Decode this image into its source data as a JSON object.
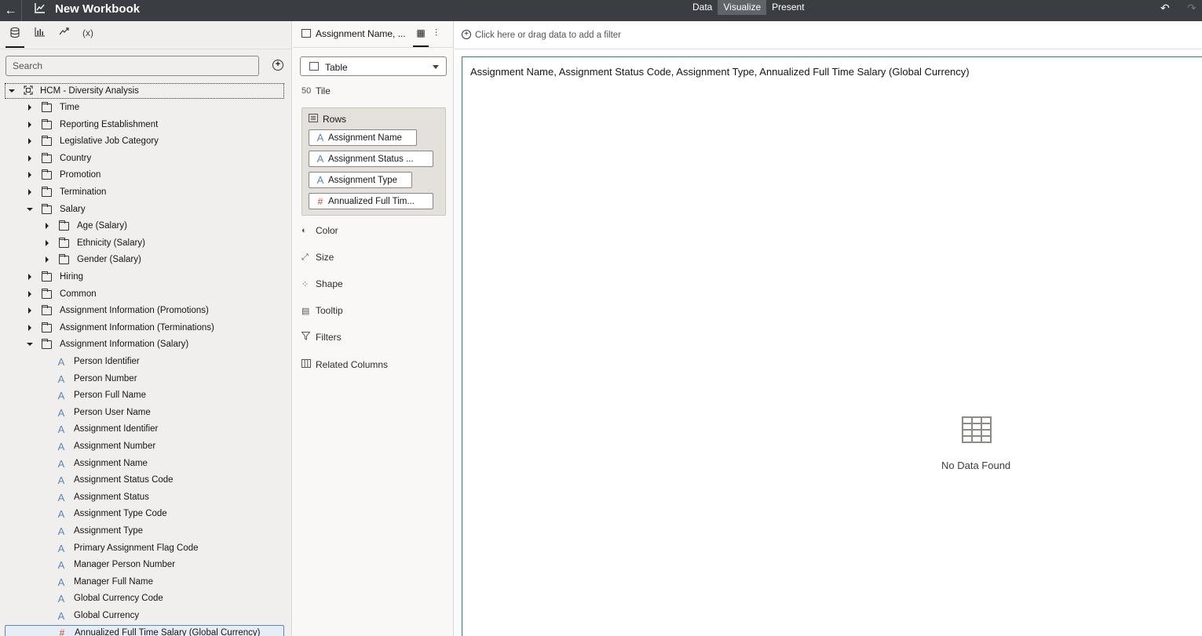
{
  "topbar": {
    "title": "New Workbook",
    "modes": [
      "Data",
      "Visualize",
      "Present"
    ],
    "active_mode": "Visualize"
  },
  "left": {
    "search_placeholder": "Search",
    "tabs": [
      "data-icon",
      "visualizations-icon",
      "analytics-icon",
      "calculations-icon"
    ],
    "calc_tab_label": "(x)",
    "root": "HCM - Diversity Analysis",
    "tree": [
      {
        "label": "Time",
        "kind": "folder",
        "level": 1,
        "state": "collapsed"
      },
      {
        "label": "Reporting Establishment",
        "kind": "folder",
        "level": 1,
        "state": "collapsed"
      },
      {
        "label": "Legislative Job Category",
        "kind": "folder",
        "level": 1,
        "state": "collapsed"
      },
      {
        "label": "Country",
        "kind": "folder",
        "level": 1,
        "state": "collapsed"
      },
      {
        "label": "Promotion",
        "kind": "folder",
        "level": 1,
        "state": "collapsed"
      },
      {
        "label": "Termination",
        "kind": "folder",
        "level": 1,
        "state": "collapsed"
      },
      {
        "label": "Salary",
        "kind": "folder",
        "level": 1,
        "state": "expanded"
      },
      {
        "label": "Age (Salary)",
        "kind": "folder",
        "level": 2,
        "state": "collapsed"
      },
      {
        "label": "Ethnicity (Salary)",
        "kind": "folder",
        "level": 2,
        "state": "collapsed"
      },
      {
        "label": "Gender (Salary)",
        "kind": "folder",
        "level": 2,
        "state": "collapsed"
      },
      {
        "label": "Hiring",
        "kind": "folder",
        "level": 1,
        "state": "collapsed"
      },
      {
        "label": "Common",
        "kind": "folder",
        "level": 1,
        "state": "collapsed"
      },
      {
        "label": "Assignment Information (Promotions)",
        "kind": "folder",
        "level": 1,
        "state": "collapsed"
      },
      {
        "label": "Assignment Information (Terminations)",
        "kind": "folder",
        "level": 1,
        "state": "collapsed"
      },
      {
        "label": "Assignment Information (Salary)",
        "kind": "folder",
        "level": 1,
        "state": "expanded"
      },
      {
        "label": "Person Identifier",
        "kind": "attribute",
        "level": 2
      },
      {
        "label": "Person Number",
        "kind": "attribute",
        "level": 2
      },
      {
        "label": "Person Full Name",
        "kind": "attribute",
        "level": 2
      },
      {
        "label": "Person User Name",
        "kind": "attribute",
        "level": 2
      },
      {
        "label": "Assignment Identifier",
        "kind": "attribute",
        "level": 2
      },
      {
        "label": "Assignment Number",
        "kind": "attribute",
        "level": 2
      },
      {
        "label": "Assignment Name",
        "kind": "attribute",
        "level": 2
      },
      {
        "label": "Assignment Status Code",
        "kind": "attribute",
        "level": 2
      },
      {
        "label": "Assignment Status",
        "kind": "attribute",
        "level": 2
      },
      {
        "label": "Assignment Type Code",
        "kind": "attribute",
        "level": 2
      },
      {
        "label": "Assignment Type",
        "kind": "attribute",
        "level": 2
      },
      {
        "label": "Primary Assignment Flag Code",
        "kind": "attribute",
        "level": 2
      },
      {
        "label": "Manager Person Number",
        "kind": "attribute",
        "level": 2
      },
      {
        "label": "Manager Full Name",
        "kind": "attribute",
        "level": 2
      },
      {
        "label": "Global Currency Code",
        "kind": "attribute",
        "level": 2
      },
      {
        "label": "Global Currency",
        "kind": "attribute",
        "level": 2
      },
      {
        "label": "Annualized Full Time Salary (Global Currency)",
        "kind": "measure",
        "level": 2,
        "selected": true
      }
    ]
  },
  "middle": {
    "viz_name": "Assignment Name, ...",
    "viz_type": "Table",
    "grammar": {
      "tile": "Tile",
      "rows": "Rows",
      "color": "Color",
      "size": "Size",
      "shape": "Shape",
      "tooltip": "Tooltip",
      "filters": "Filters",
      "related": "Related Columns"
    },
    "tile_icon_text": "50",
    "row_pills": [
      {
        "label": "Assignment Name",
        "kind": "attribute"
      },
      {
        "label": "Assignment Status ...",
        "kind": "attribute"
      },
      {
        "label": "Assignment Type",
        "kind": "attribute"
      },
      {
        "label": "Annualized Full Tim...",
        "kind": "measure"
      }
    ]
  },
  "canvas": {
    "filter_hint": "Click here or drag data to add a filter",
    "viz_title": "Assignment Name, Assignment Status Code, Assignment Type, Annualized Full Time Salary (Global Currency)",
    "empty_message": "No Data Found"
  },
  "colors": {
    "topbar": "#3a3d42",
    "panel": "#f1efed",
    "attribute": "#5a87b5",
    "measure": "#c74634",
    "viz_border": "#2d7d7a"
  }
}
